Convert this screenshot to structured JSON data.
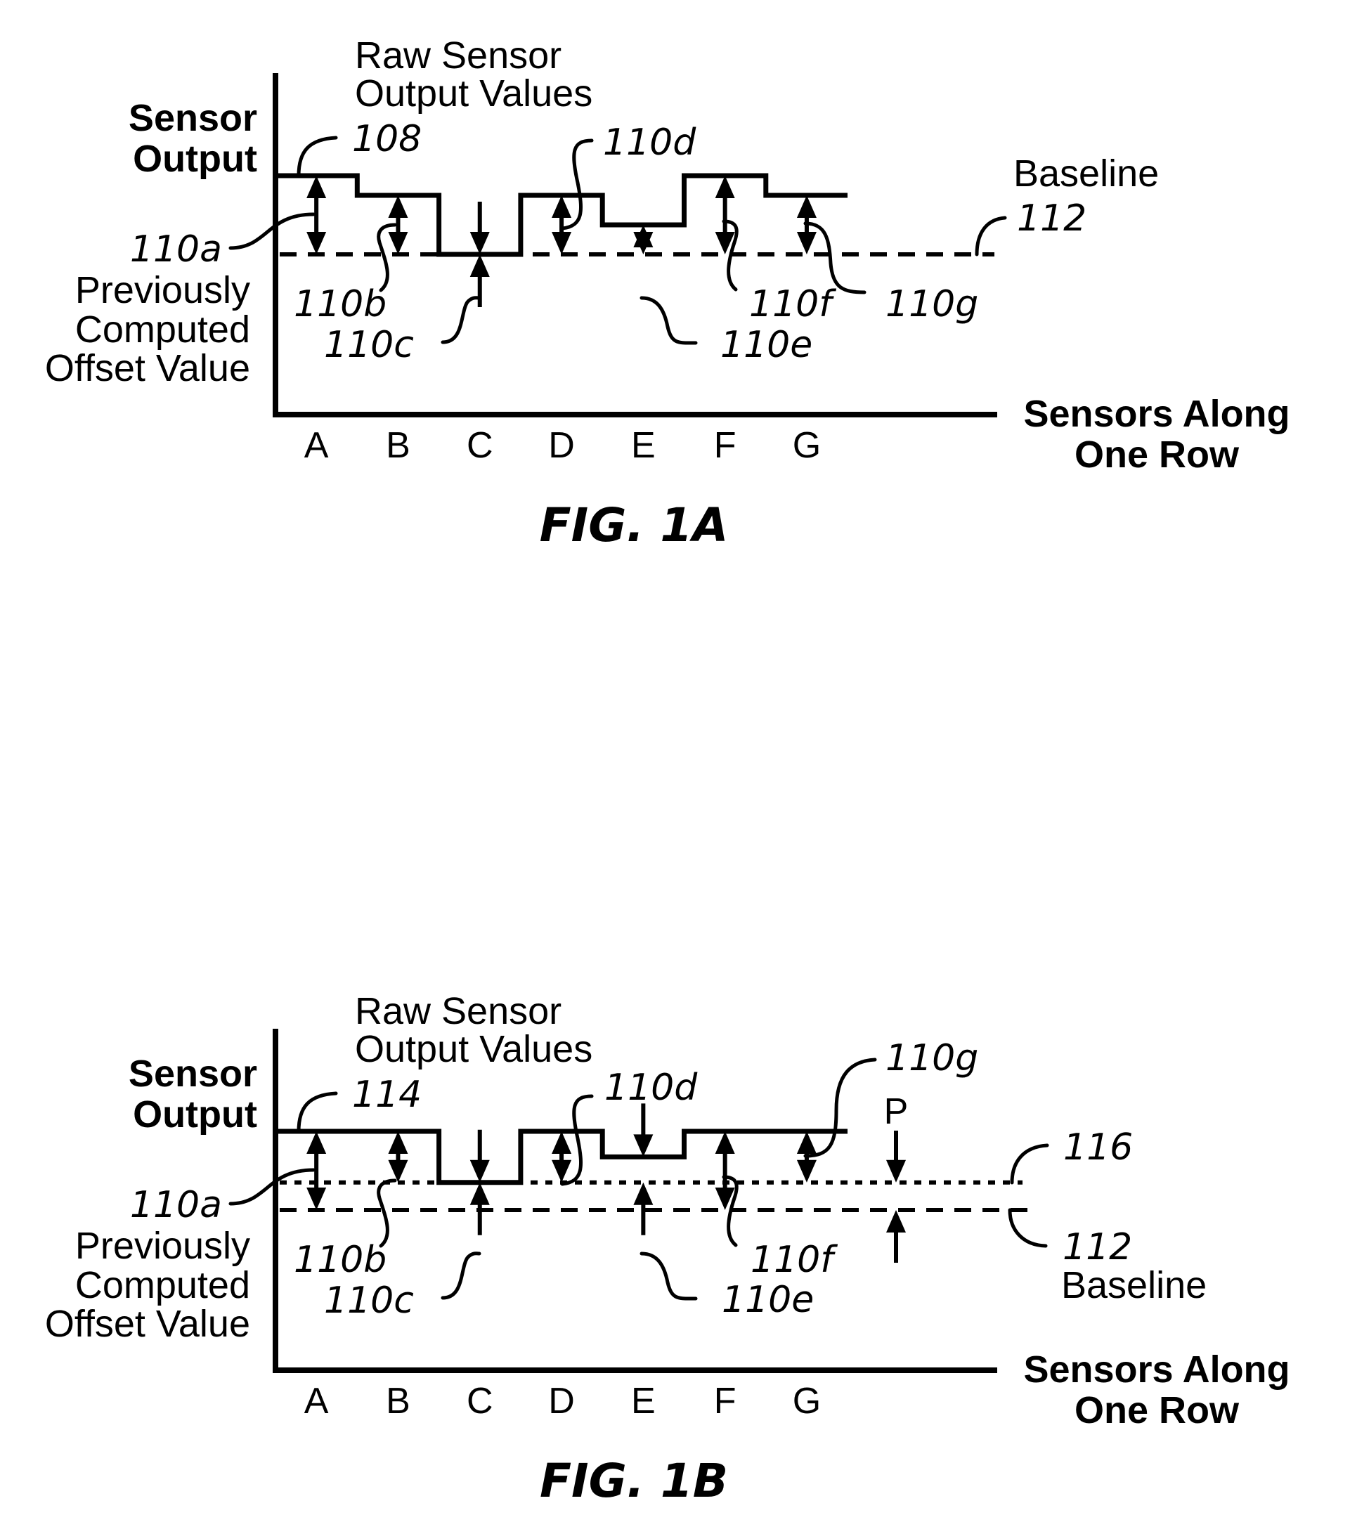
{
  "figures": [
    {
      "id": "fig1a",
      "caption": "FIG. 1A",
      "y_axis_label": [
        "Sensor",
        "Output"
      ],
      "x_axis_label": [
        "Sensors Along",
        "One Row"
      ],
      "trace_label": [
        "Raw Sensor",
        "Output Values"
      ],
      "offset_label": [
        "Previously",
        "Computed",
        "Offset Value"
      ],
      "baseline_label": "Baseline",
      "sensors": [
        "A",
        "B",
        "C",
        "D",
        "E",
        "F",
        "G"
      ],
      "raw_levels": [
        4,
        3,
        0,
        3,
        1.5,
        4,
        3
      ],
      "baseline_level": 0,
      "secondary_baseline_level": null,
      "refs": {
        "trace": "108",
        "baseline": "112",
        "secondary_baseline": null,
        "offsets": [
          "110a",
          "110b",
          "110c",
          "110d",
          "110e",
          "110f",
          "110g"
        ]
      },
      "extra_marker": null
    },
    {
      "id": "fig1b",
      "caption": "FIG. 1B",
      "y_axis_label": [
        "Sensor",
        "Output"
      ],
      "x_axis_label": [
        "Sensors Along",
        "One Row"
      ],
      "trace_label": [
        "Raw Sensor",
        "Output Values"
      ],
      "offset_label": [
        "Previously",
        "Computed",
        "Offset Value"
      ],
      "baseline_label": "Baseline",
      "sensors": [
        "A",
        "B",
        "C",
        "D",
        "E",
        "F",
        "G"
      ],
      "raw_levels": [
        4,
        4,
        1.4,
        4,
        2.7,
        4,
        4
      ],
      "baseline_level": 0,
      "secondary_baseline_level": 1.4,
      "refs": {
        "trace": "114",
        "baseline": "112",
        "secondary_baseline": "116",
        "offsets": [
          "110a",
          "110b",
          "110c",
          "110d",
          "110e",
          "110f",
          "110g"
        ]
      },
      "extra_marker": {
        "label": "P"
      }
    }
  ]
}
